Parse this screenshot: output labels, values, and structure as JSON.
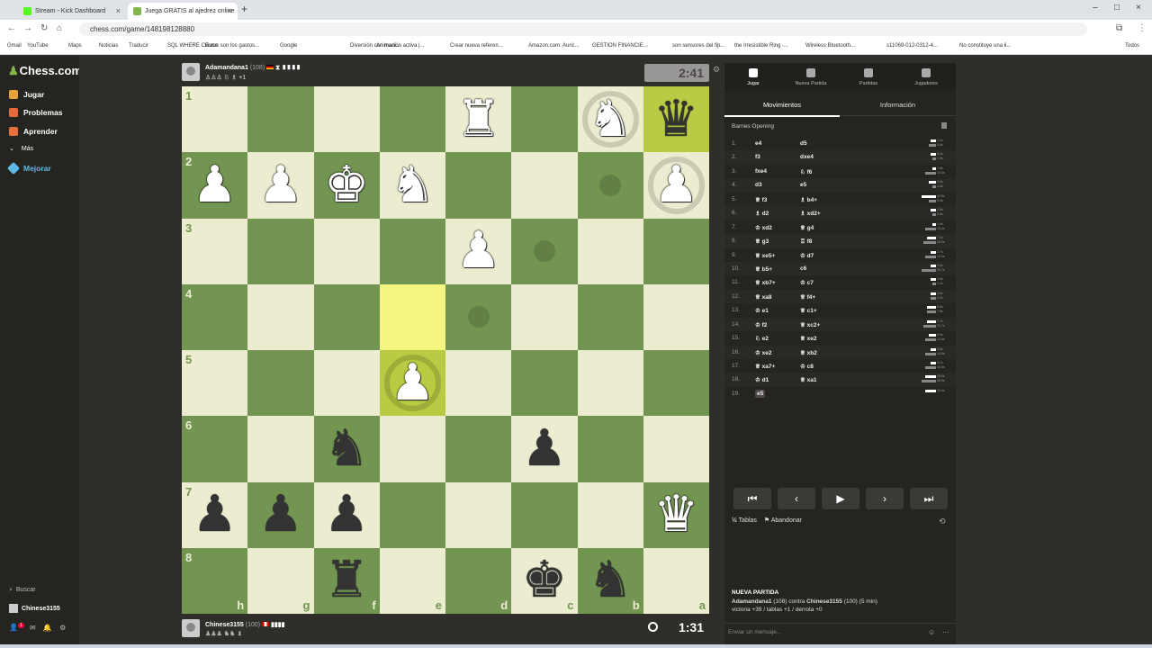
{
  "browser": {
    "tabs": [
      {
        "label": "Stream - Kick Dashboard",
        "color": "#53fc18"
      },
      {
        "label": "Juega GRATIS al ajedrez online",
        "color": "#81b64c"
      }
    ],
    "new_tab": "+",
    "url": "chess.com/game/148198128880",
    "bookmarks": [
      "Gmail",
      "YouTube",
      "Maps",
      "Noticias",
      "Traducir",
      "SQL WHERE Clause",
      "Estos son los gastos...",
      "Google",
      "Diversión con mani...",
      "Animación activa |...",
      "Crear nueva referen...",
      "Amazon.com: Auric...",
      "GESTION FINANCIE...",
      "son sensores del fip...",
      "the Irresistible Ring -...",
      "Wireless Bluetooth...",
      "s11069-012-0312-4...",
      "No constituye una li...",
      "Todos"
    ]
  },
  "sidebar": {
    "logo": "Chess.com",
    "items": [
      {
        "label": "Jugar",
        "color": "#e8a23a"
      },
      {
        "label": "Problemas",
        "color": "#e86a3a"
      },
      {
        "label": "Aprender",
        "color": "#e8703a"
      },
      {
        "label": "Más",
        "color": "#888888"
      },
      {
        "label": "Mejorar",
        "color": "#5fb9e8"
      }
    ],
    "search": "Buscar",
    "user": "Chinese3155",
    "notif_badge": "1"
  },
  "top_player": {
    "name": "Adamandana1",
    "rating": "(108)",
    "clock": "2:41",
    "meta": "+1"
  },
  "bottom_player": {
    "name": "Chinese3155",
    "rating": "(100)",
    "clock": "1:31"
  },
  "board": {
    "ranks": [
      "1",
      "2",
      "3",
      "4",
      "5",
      "6",
      "7",
      "8"
    ],
    "files": [
      "h",
      "g",
      "f",
      "e",
      "d",
      "c",
      "b",
      "a"
    ],
    "pieces": [
      {
        "r": 0,
        "c": 4,
        "p": "♜",
        "w": true
      },
      {
        "r": 0,
        "c": 6,
        "p": "♞",
        "w": true
      },
      {
        "r": 0,
        "c": 7,
        "p": "♛",
        "w": false
      },
      {
        "r": 1,
        "c": 0,
        "p": "♟",
        "w": true
      },
      {
        "r": 1,
        "c": 1,
        "p": "♟",
        "w": true
      },
      {
        "r": 1,
        "c": 2,
        "p": "♚",
        "w": true
      },
      {
        "r": 1,
        "c": 3,
        "p": "♞",
        "w": true
      },
      {
        "r": 1,
        "c": 7,
        "p": "♟",
        "w": true
      },
      {
        "r": 2,
        "c": 4,
        "p": "♟",
        "w": true
      },
      {
        "r": 4,
        "c": 3,
        "p": "♟",
        "w": true
      },
      {
        "r": 5,
        "c": 2,
        "p": "♞",
        "w": false
      },
      {
        "r": 5,
        "c": 5,
        "p": "♟",
        "w": false
      },
      {
        "r": 6,
        "c": 0,
        "p": "♟",
        "w": false
      },
      {
        "r": 6,
        "c": 1,
        "p": "♟",
        "w": false
      },
      {
        "r": 6,
        "c": 2,
        "p": "♟",
        "w": false
      },
      {
        "r": 6,
        "c": 7,
        "p": "♛",
        "w": true
      },
      {
        "r": 7,
        "c": 2,
        "p": "♜",
        "w": false
      },
      {
        "r": 7,
        "c": 5,
        "p": "♚",
        "w": false
      },
      {
        "r": 7,
        "c": 6,
        "p": "♞",
        "w": false
      }
    ],
    "highlights": [
      {
        "r": 3,
        "c": 3
      },
      {
        "r": 4,
        "c": 3
      },
      {
        "r": 0,
        "c": 7
      }
    ],
    "rings": [
      {
        "r": 0,
        "c": 6
      },
      {
        "r": 1,
        "c": 7
      },
      {
        "r": 4,
        "c": 3
      }
    ],
    "dots": [
      {
        "r": 1,
        "c": 6
      },
      {
        "r": 2,
        "c": 5
      },
      {
        "r": 3,
        "c": 4
      }
    ]
  },
  "panel": {
    "tabs": [
      "Jugar",
      "Nueva Partida",
      "Partidas",
      "Jugadores"
    ],
    "subtabs": [
      "Movimientos",
      "Información"
    ],
    "opening": "Barnes Opening",
    "moves": [
      {
        "n": "1.",
        "w": "e4",
        "b": "d5",
        "t1": "1.2s",
        "t2": "3.4s",
        "ww": 6,
        "bw": 8
      },
      {
        "n": "2.",
        "w": "f3",
        "b": "dxe4",
        "t1": "3.3s",
        "t2": "1.9s",
        "ww": 6,
        "bw": 4
      },
      {
        "n": "3.",
        "w": "fxe4",
        "b": "♘ f6",
        "t1": "1.6s",
        "t2": "10.0s",
        "ww": 4,
        "bw": 12
      },
      {
        "n": "4.",
        "w": "d3",
        "b": "e5",
        "t1": "4.3s",
        "t2": "1.4s",
        "ww": 8,
        "bw": 4
      },
      {
        "n": "5.",
        "w": "♕ f3",
        "b": "♗ b4+",
        "t1": "42.8s",
        "t2": "5.3s",
        "ww": 16,
        "bw": 8
      },
      {
        "n": "6.",
        "w": "♗ d2",
        "b": "♗ xd2+",
        "t1": "2.8s",
        "t2": "2.0s",
        "ww": 6,
        "bw": 4
      },
      {
        "n": "7.",
        "w": "♔ xd2",
        "b": "♕ g4",
        "t1": "1.9s",
        "t2": "13.4s",
        "ww": 4,
        "bw": 12
      },
      {
        "n": "8.",
        "w": "♕ g3",
        "b": "♖ f8",
        "t1": "7.1s",
        "t2": "16.0s",
        "ww": 10,
        "bw": 14
      },
      {
        "n": "9.",
        "w": "♕ xe5+",
        "b": "♔ d7",
        "t1": "2.7s",
        "t2": "13.3s",
        "ww": 6,
        "bw": 12
      },
      {
        "n": "10.",
        "w": "♕ b5+",
        "b": "c6",
        "t1": "3.9s",
        "t2": "24.7s",
        "ww": 6,
        "bw": 16
      },
      {
        "n": "11.",
        "w": "♕ xb7+",
        "b": "♔ c7",
        "t1": "2.6s",
        "t2": "1.4s",
        "ww": 6,
        "bw": 4
      },
      {
        "n": "12.",
        "w": "♕ xa8",
        "b": "♕ f4+",
        "t1": "3.6s",
        "t2": "2.9s",
        "ww": 6,
        "bw": 6
      },
      {
        "n": "13.",
        "w": "♔ e1",
        "b": "♕ c1+",
        "t1": "8.8s",
        "t2": "7.8s",
        "ww": 10,
        "bw": 10
      },
      {
        "n": "14.",
        "w": "♔ f2",
        "b": "♕ xc2+",
        "t1": "7.7s",
        "t2": "21.7s",
        "ww": 10,
        "bw": 14
      },
      {
        "n": "15.",
        "w": "♘ e2",
        "b": "♕ xe2",
        "t1": "5.9s",
        "t2": "12.6s",
        "ww": 8,
        "bw": 12
      },
      {
        "n": "16.",
        "w": "♔ xe2",
        "b": "♕ xb2",
        "t1": "3.6s",
        "t2": "14.9s",
        "ww": 6,
        "bw": 12
      },
      {
        "n": "17.",
        "w": "♕ xa7+",
        "b": "♔ c8",
        "t1": "3.1s",
        "t2": "16.5s",
        "ww": 6,
        "bw": 12
      },
      {
        "n": "18.",
        "w": "♔ d1",
        "b": "♕ xa1",
        "t1": "18.0s",
        "t2": "30.9s",
        "ww": 12,
        "bw": 16
      },
      {
        "n": "19.",
        "w": "e5",
        "b": "",
        "t1": "16.4s",
        "t2": "",
        "ww": 12,
        "bw": 0
      }
    ],
    "controls": [
      "⏮",
      "‹",
      "▶",
      "›",
      "⏭"
    ],
    "draw": "Tablas",
    "resign": "Abandonar",
    "game_title": "NUEVA PARTIDA",
    "players_line_a": "Adamandana1",
    "players_line_b": "(108) contra",
    "players_line_c": "Chinese3155",
    "players_line_d": "(100) (5 min)",
    "record": "victoria +39 / tablas +1 / derrota +0",
    "chat_placeholder": "Enviar un mensaje..."
  }
}
